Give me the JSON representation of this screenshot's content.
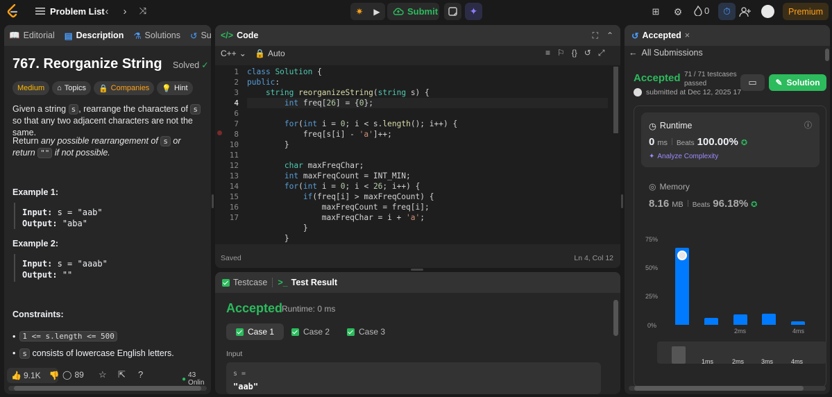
{
  "topbar": {
    "problem_list": "Problem List",
    "submit": "Submit",
    "streak": "0",
    "premium": "Premium"
  },
  "left": {
    "tabs": [
      "Editorial",
      "Description",
      "Solutions",
      "Submi"
    ],
    "title": "767. Reorganize String",
    "solved": "Solved",
    "tags": {
      "difficulty": "Medium",
      "topics": "Topics",
      "companies": "Companies",
      "hint": "Hint"
    },
    "desc1_a": "Given a string ",
    "desc1_s": "s",
    "desc1_b": ", rearrange the characters of ",
    "desc1_c": " so that any two adjacent characters are not the same.",
    "desc2_a": "Return ",
    "desc2_b": "any possible rearrangement of ",
    "desc2_c": " or return ",
    "desc2_empty": "\"\"",
    "desc2_d": " if not possible.",
    "example1": {
      "title": "Example 1:",
      "input_label": "Input:",
      "input": "s = \"aab\"",
      "output_label": "Output:",
      "output": "\"aba\""
    },
    "example2": {
      "title": "Example 2:",
      "input_label": "Input:",
      "input": "s = \"aaab\"",
      "output_label": "Output:",
      "output": "\"\""
    },
    "constraints_title": "Constraints:",
    "constraint1": "1 <= s.length <= 500",
    "constraint2_code": "s",
    "constraint2_text": " consists of lowercase English letters.",
    "likes": "9.1K",
    "comments": "89",
    "online": "43 Onlin"
  },
  "code": {
    "title": "Code",
    "language": "C++",
    "auto": "Auto",
    "status": "Saved",
    "cursor": "Ln 4, Col 12"
  },
  "testresult": {
    "tab_testcase": "Testcase",
    "tab_result": "Test Result",
    "verdict": "Accepted",
    "runtime": "Runtime: 0 ms",
    "cases": [
      "Case 1",
      "Case 2",
      "Case 3"
    ],
    "input_label": "Input",
    "var_name": "s =",
    "var_value": "\"aab\""
  },
  "right": {
    "tab_title": "Accepted",
    "all_submissions": "All Submissions",
    "verdict": "Accepted",
    "testcases": "71 / 71 testcases",
    "passed": "passed",
    "submitted": "submitted at Dec 12, 2025 17",
    "solution_btn": "Solution",
    "runtime_title": "Runtime",
    "runtime_value": "0",
    "runtime_unit": "ms",
    "beats_label": "Beats",
    "runtime_beats": "100.00%",
    "analyze": "Analyze Complexity",
    "memory_title": "Memory",
    "memory_value": "8.16",
    "memory_unit": "MB",
    "memory_beats": "96.18%"
  },
  "chart_data": {
    "type": "bar",
    "y_ticks": [
      "75%",
      "50%",
      "25%",
      "0%"
    ],
    "x_ticks": [
      "2ms",
      "4ms"
    ],
    "ylim": [
      0,
      75
    ],
    "values": [
      68,
      6,
      9,
      10,
      3
    ],
    "mini_ticks": [
      "1ms",
      "2ms",
      "3ms",
      "4ms"
    ]
  },
  "colors": {
    "accent_green": "#2cbb5d",
    "medium": "#ffb800",
    "premium": "#ffa116",
    "blue": "#007aff"
  }
}
